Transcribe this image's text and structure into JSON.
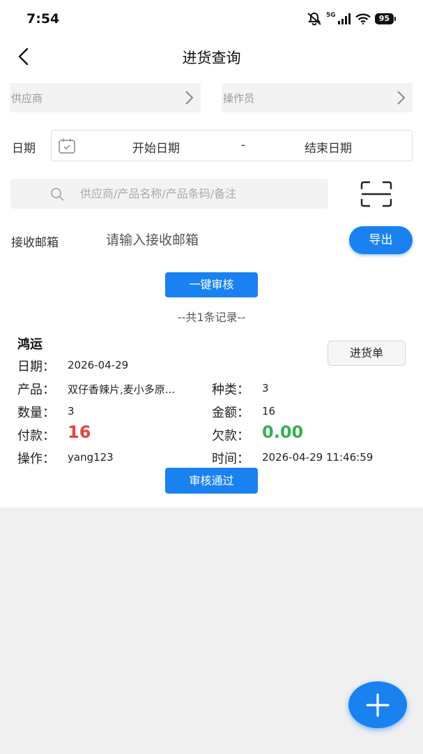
{
  "status_bar": {
    "time": "7:54",
    "network": "5G",
    "battery": "95"
  },
  "header": {
    "title": "进货查询"
  },
  "filters": {
    "supplier_placeholder": "供应商",
    "operator_placeholder": "操作员",
    "date_label": "日期",
    "start_date": "开始日期",
    "date_separator": "-",
    "end_date": "结束日期",
    "search_placeholder": "供应商/产品名称/产品条码/备注",
    "email_label": "接收邮箱",
    "email_placeholder": "请输入接收邮箱",
    "export_label": "导出"
  },
  "audit_all_label": "一键审核",
  "record_count": "--共1条记录--",
  "records": [
    {
      "supplier": "鸿运",
      "invoice_button": "进货单",
      "date_label": "日期：",
      "date": "2026-04-29",
      "product_label": "产品：",
      "product": "双仔香辣片,麦小多原...",
      "category_label": "种类：",
      "category_count": "3",
      "quantity_label": "数量：",
      "quantity": "3",
      "amount_label": "金额：",
      "amount": "16",
      "paid_label": "付款：",
      "paid": "16",
      "debt_label": "欠款：",
      "debt": "0.00",
      "operator_label": "操作：",
      "operator": "yang123",
      "time_label": "时间：",
      "time": "2026-04-29 11:46:59",
      "approve_label": "审核通过"
    }
  ],
  "colors": {
    "accent": "#1a82f0",
    "paid": "#e0473c",
    "debt": "#3aad55"
  }
}
